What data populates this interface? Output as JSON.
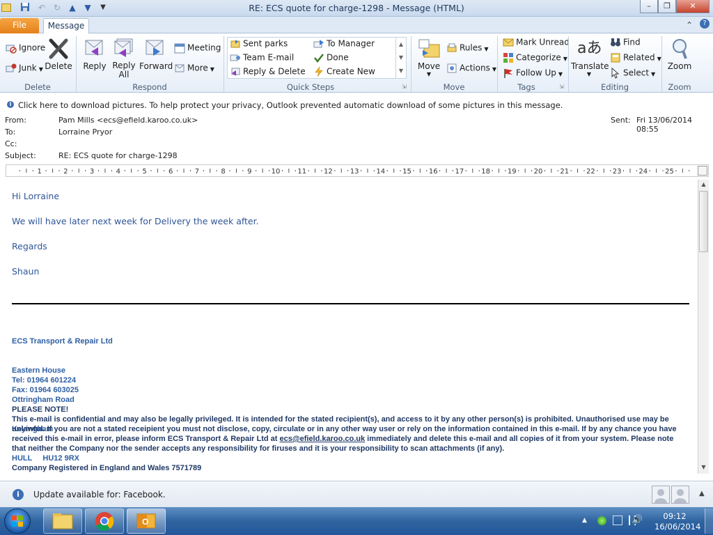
{
  "window": {
    "title": "RE: ECS quote for charge-1298  -  Message (HTML)"
  },
  "tabs": {
    "file": "File",
    "message": "Message"
  },
  "ribbon": {
    "delete_group": {
      "label": "Delete",
      "ignore": "Ignore",
      "junk": "Junk",
      "delete": "Delete"
    },
    "respond_group": {
      "label": "Respond",
      "reply": "Reply",
      "reply_all_1": "Reply",
      "reply_all_2": "All",
      "forward": "Forward",
      "meeting": "Meeting",
      "more": "More"
    },
    "quick_steps_group": {
      "label": "Quick Steps",
      "items": [
        "Sent parks",
        "Team E-mail",
        "Reply & Delete",
        "To Manager",
        "Done",
        "Create New"
      ]
    },
    "move_group": {
      "label": "Move",
      "move": "Move",
      "rules": "Rules",
      "actions": "Actions"
    },
    "tags_group": {
      "label": "Tags",
      "mark_unread": "Mark Unread",
      "categorize": "Categorize",
      "follow_up": "Follow Up"
    },
    "editing_group": {
      "label": "Editing",
      "translate": "Translate",
      "find": "Find",
      "related": "Related",
      "select": "Select"
    },
    "zoom_group": {
      "label": "Zoom",
      "zoom": "Zoom"
    }
  },
  "infobar": {
    "text": "Click here to download pictures. To help protect your privacy, Outlook prevented automatic download of some pictures in this message."
  },
  "header": {
    "from_label": "From:",
    "from_value": "Pam Mills <ecs@efield.karoo.co.uk>",
    "to_label": "To:",
    "to_value": "Lorraine Pryor",
    "cc_label": "Cc:",
    "subject_label": "Subject:",
    "subject_value": "RE: ECS quote for charge-1298",
    "sent_label": "Sent:",
    "sent_value": "Fri 13/06/2014 08:55"
  },
  "ruler": {
    "numbers": [
      "1",
      "2",
      "3",
      "4",
      "5",
      "6",
      "7",
      "8",
      "9",
      "10",
      "11",
      "12",
      "13",
      "14",
      "15",
      "16",
      "17",
      "18",
      "19",
      "20",
      "21",
      "22",
      "23",
      "24",
      "25"
    ]
  },
  "body": {
    "greeting": "Hi Lorraine",
    "line1": "We will have later next week for Delivery the week after.",
    "regards": "Regards",
    "name": "Shaun",
    "address": [
      "ECS Transport & Repair Ltd",
      "Eastern House",
      "Ottringham Road",
      "Keyingham",
      "HULL     HU12 9RX"
    ],
    "tel": "Tel: 01964 601224",
    "fax": "Fax: 01964 603025",
    "note_title": "PLEASE NOTE!",
    "note_1": "This e-mail is confidential and may also be legally privileged.  It is intended for the stated recipient(s), and access to it by any other person(s) is prohibited.  Unauthorised use may be unlawful.  If you are not a stated receipient you must not disclose, copy, circulate or in any other way user or rely on the information contained in this e-mail.  If by any chance you have received this e-mail in error, please inform ECS Transport & Repair Ltd at ",
    "note_link": "ecs@efield.karoo.co.uk",
    "note_2": " immediately and delete this e-mail and all copies of it from your system.  Please note that neither the Company nor the sender accepts any responsibility for firuses and it is your responsibility to scan attachments (if any).",
    "company_reg": "Company Registered in England and Wales 7571789"
  },
  "people_pane": {
    "update_text": "Update available for: Facebook."
  },
  "taskbar": {
    "time": "09:12",
    "date": "16/06/2014"
  },
  "colors": {
    "ribbon_accent": "#2a5aa5",
    "file_tab": "#e4811b",
    "body_text": "#2f5597",
    "signature": "#2e5fa3",
    "taskbar": "#2f64a0"
  }
}
